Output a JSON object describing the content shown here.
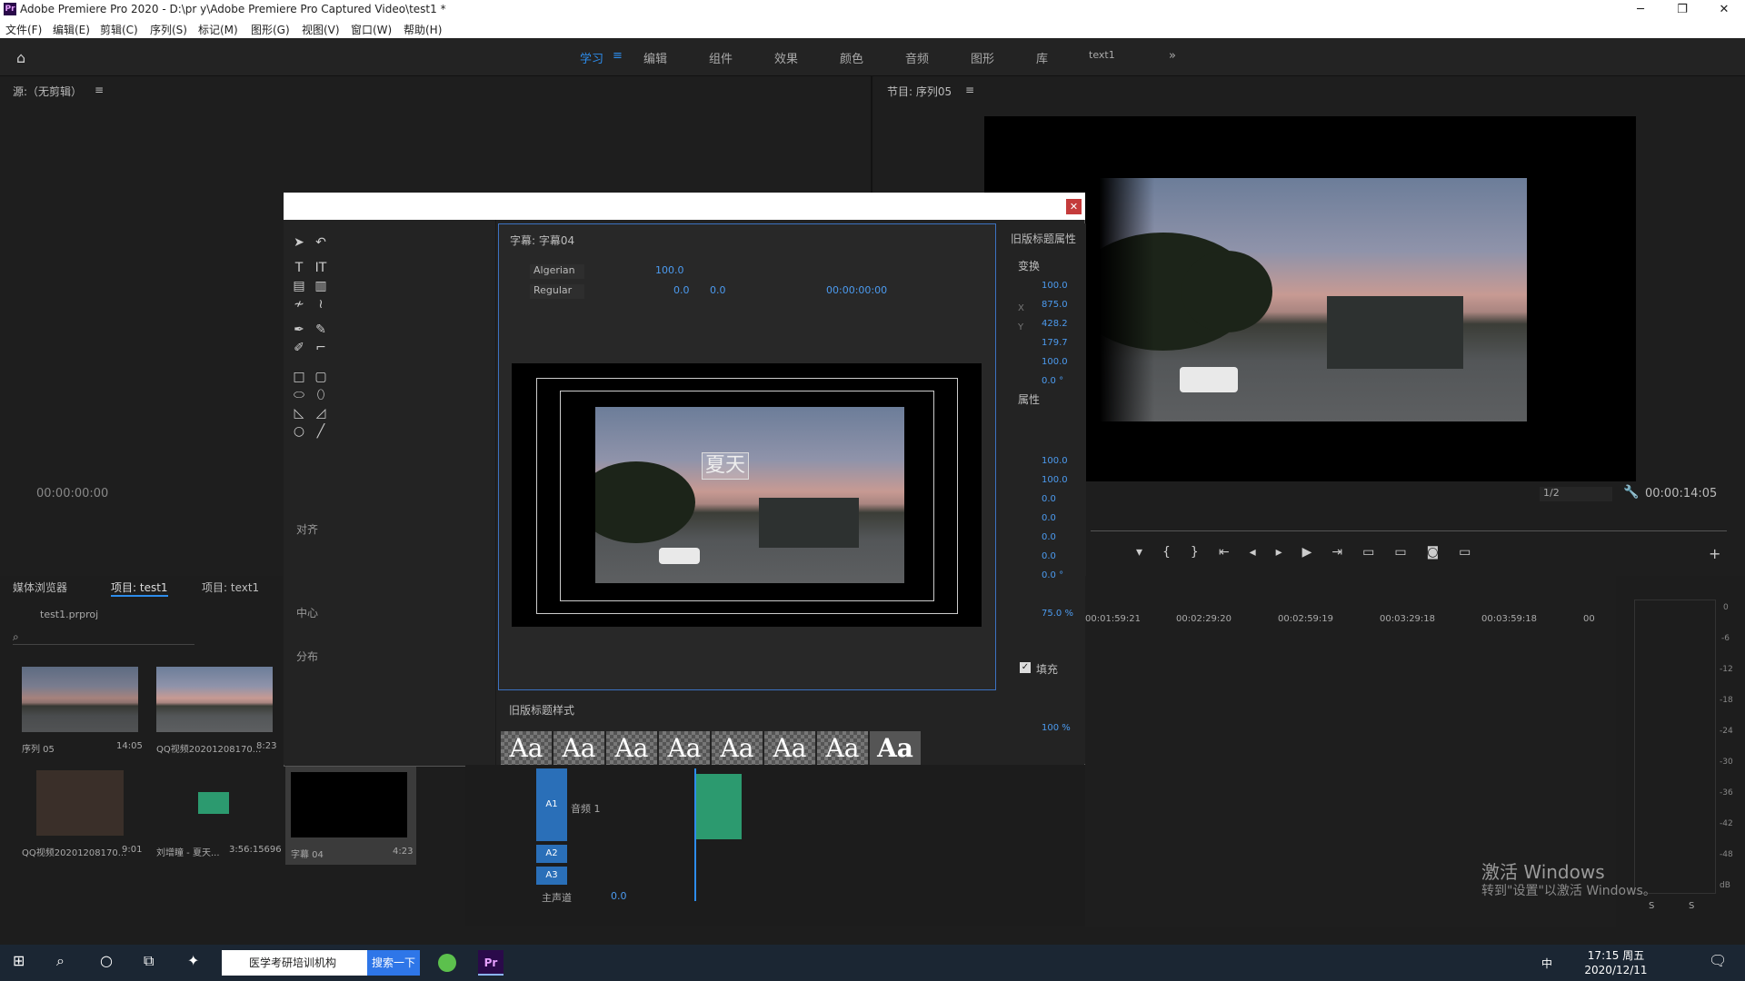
{
  "window": {
    "title": "Adobe Premiere Pro 2020 - D:\\pr y\\Adobe Premiere Pro Captured Video\\test1 *",
    "app_icon": "Pr"
  },
  "menu": [
    "文件(F)",
    "编辑(E)",
    "剪辑(C)",
    "序列(S)",
    "标记(M)",
    "图形(G)",
    "视图(V)",
    "窗口(W)",
    "帮助(H)"
  ],
  "workspaces": [
    "学习",
    "编辑",
    "组件",
    "效果",
    "颜色",
    "音频",
    "图形",
    "库",
    "text1"
  ],
  "source": {
    "title": "源:（无剪辑）",
    "timecode": "00:00:00:00"
  },
  "program": {
    "title": "节目: 序列05",
    "zoom": "1/2",
    "timecode": "00:00:14:05"
  },
  "titler": {
    "title": "字幕: 字幕04",
    "font": "Algerian",
    "style": "Regular",
    "size": "100.0",
    "leading": "0.0",
    "kerning": "0.0",
    "tracking": "0.0",
    "time": "00:00:00:00",
    "text": "夏天"
  },
  "tools": {
    "align": "对齐",
    "center": "中心",
    "distribute": "分布"
  },
  "props": {
    "title": "旧版标题属性",
    "transform": "变换",
    "attributes": "属性",
    "fill": "填充",
    "values": [
      "100.0",
      "875.0",
      "428.2",
      "179.7",
      "100.0",
      "0.0 °",
      "100.0",
      "100.0",
      "0.0",
      "0.0",
      "0.0",
      "0.0",
      "0.0 °",
      "75.0 %",
      "100 %"
    ],
    "x_label": "X",
    "y_label": "Y"
  },
  "styles": {
    "title": "旧版标题样式",
    "sample": "Aa"
  },
  "project": {
    "tabs": [
      "媒体浏览器",
      "项目: test1",
      "项目: text1"
    ],
    "file": "test1.prproj",
    "items": [
      {
        "name": "序列 05",
        "dur": "14:05"
      },
      {
        "name": "QQ视频20201208170...",
        "dur": "8:23"
      },
      {
        "name": "QQ视频20201208170...",
        "dur": "9:01"
      },
      {
        "name": "刘增瞳 - 夏天...",
        "dur": "3:56:15696"
      },
      {
        "name": "字幕 04",
        "dur": "4:23"
      }
    ]
  },
  "timeline": {
    "ruler": [
      "00:01:59:21",
      "00:02:29:20",
      "00:02:59:19",
      "00:03:29:18",
      "00:03:59:18",
      "00"
    ],
    "tracks": [
      "A1",
      "A2",
      "A3"
    ],
    "a1_name": "音频 1",
    "master": "主声道",
    "master_val": "0.0"
  },
  "meter": {
    "scale": [
      "0",
      "-6",
      "-12",
      "-18",
      "-24",
      "-30",
      "-36",
      "-42",
      "-48",
      "dB"
    ],
    "solo": [
      "S",
      "S"
    ]
  },
  "watermark": {
    "line1": "激活 Windows",
    "line2": "转到\"设置\"以激活 Windows。"
  },
  "taskbar": {
    "browser_tab": "医学考研培训机构",
    "search_btn": "搜索一下",
    "time": "17:15 周五",
    "date": "2020/12/11",
    "ime": "中"
  }
}
